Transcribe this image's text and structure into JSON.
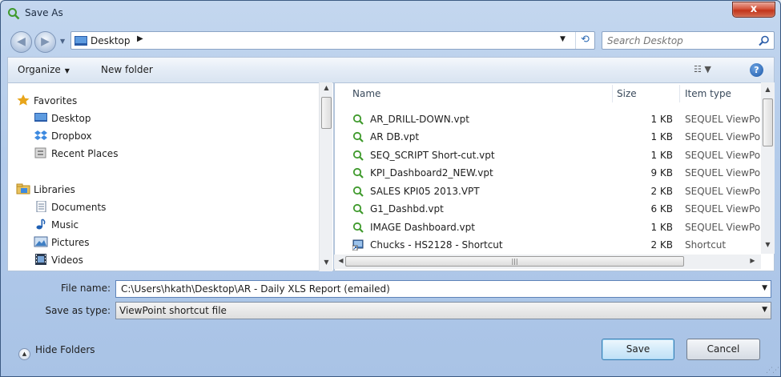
{
  "window": {
    "title": "Save As",
    "close_label": "x"
  },
  "nav": {
    "back_glyph": "◀",
    "forward_glyph": "▶",
    "history_dropdown_glyph": "▼"
  },
  "address": {
    "location": "Desktop",
    "chevron": "▶",
    "dropdown_glyph": "▼",
    "refresh_glyph": "⟲"
  },
  "search": {
    "placeholder": "Search Desktop"
  },
  "toolbar": {
    "organize_label": "Organize",
    "organize_caret": "▼",
    "new_folder_label": "New folder",
    "view_glyph": "☷ ▼",
    "help_glyph": "?"
  },
  "sidebar": {
    "favorites": {
      "label": "Favorites",
      "items": [
        {
          "label": "Desktop"
        },
        {
          "label": "Dropbox"
        },
        {
          "label": "Recent Places"
        }
      ]
    },
    "libraries": {
      "label": "Libraries",
      "items": [
        {
          "label": "Documents"
        },
        {
          "label": "Music"
        },
        {
          "label": "Pictures"
        },
        {
          "label": "Videos"
        }
      ]
    }
  },
  "files": {
    "columns": {
      "name": "Name",
      "size": "Size",
      "type": "Item type"
    },
    "rows": [
      {
        "name": "AR_DRILL-DOWN.vpt",
        "size": "1 KB",
        "type": "SEQUEL ViewPoir",
        "icon": "viewpoint-icon"
      },
      {
        "name": "AR DB.vpt",
        "size": "1 KB",
        "type": "SEQUEL ViewPoir",
        "icon": "viewpoint-icon"
      },
      {
        "name": "SEQ_SCRIPT Short-cut.vpt",
        "size": "1 KB",
        "type": "SEQUEL ViewPoir",
        "icon": "viewpoint-icon"
      },
      {
        "name": "KPI_Dashboard2_NEW.vpt",
        "size": "9 KB",
        "type": "SEQUEL ViewPoir",
        "icon": "viewpoint-icon"
      },
      {
        "name": "SALES KPI05 2013.VPT",
        "size": "2 KB",
        "type": "SEQUEL ViewPoir",
        "icon": "viewpoint-icon"
      },
      {
        "name": "G1_Dashbd.vpt",
        "size": "6 KB",
        "type": "SEQUEL ViewPoir",
        "icon": "viewpoint-icon"
      },
      {
        "name": "IMAGE Dashboard.vpt",
        "size": "1 KB",
        "type": "SEQUEL ViewPoir",
        "icon": "viewpoint-icon"
      },
      {
        "name": "Chucks - HS2128 - Shortcut",
        "size": "2 KB",
        "type": "Shortcut",
        "icon": "shortcut-icon"
      }
    ]
  },
  "form": {
    "file_name_label": "File name:",
    "file_name_value": "C:\\Users\\hkath\\Desktop\\AR - Daily XLS Report (emailed)",
    "save_type_label": "Save as type:",
    "save_type_value": "ViewPoint shortcut file"
  },
  "footer": {
    "hide_folders_label": "Hide Folders",
    "save_label": "Save",
    "cancel_label": "Cancel"
  },
  "colors": {
    "accent": "#3c7fb1",
    "viewpoint_icon": "#3f9a2c",
    "folder_star": "#e8a51b"
  }
}
